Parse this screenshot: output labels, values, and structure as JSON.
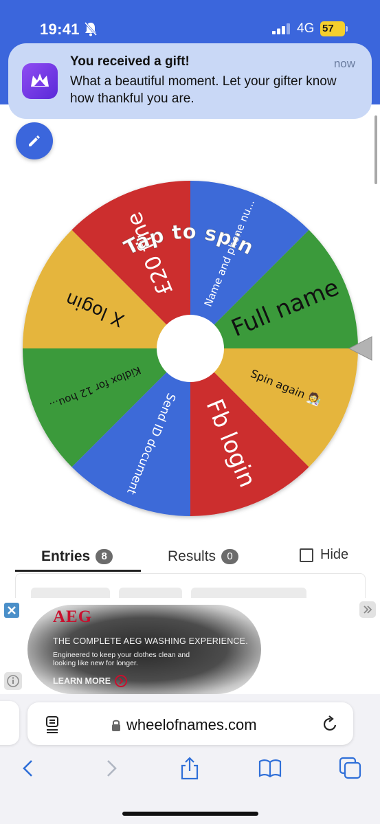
{
  "status_bar": {
    "time": "19:41",
    "network": "4G",
    "battery": "57"
  },
  "notification": {
    "title": "You received a gift!",
    "body": "What a beautiful moment. Let your gifter know how thankful you are.",
    "time": "now"
  },
  "wheel": {
    "center_prompt": "Tap to spin",
    "segments": [
      {
        "label": "Full name",
        "color": "#3a9a3a"
      },
      {
        "label": "Spin again 🧑‍🔬",
        "color": "#e5b53c"
      },
      {
        "label": "Fb login",
        "color": "#cc2e2e"
      },
      {
        "label": "Send ID document",
        "color": "#3d6ad8"
      },
      {
        "label": "Kidlox for 12 hou...",
        "color": "#3a9a3a"
      },
      {
        "label": "X login",
        "color": "#e5b53c"
      },
      {
        "label": "£20 fine",
        "color": "#cc2e2e"
      },
      {
        "label": "Name and phone nu...",
        "color": "#3d6ad8"
      }
    ]
  },
  "tabs": {
    "entries_label": "Entries",
    "entries_count": "8",
    "results_label": "Results",
    "results_count": "0",
    "hide_label": "Hide"
  },
  "ad": {
    "brand": "AEG",
    "headline": "THE COMPLETE AEG WASHING EXPERIENCE.",
    "subline": "Engineered to keep your clothes clean and looking like new for longer.",
    "cta": "LEARN MORE"
  },
  "browser": {
    "url": "wheelofnames.com"
  }
}
